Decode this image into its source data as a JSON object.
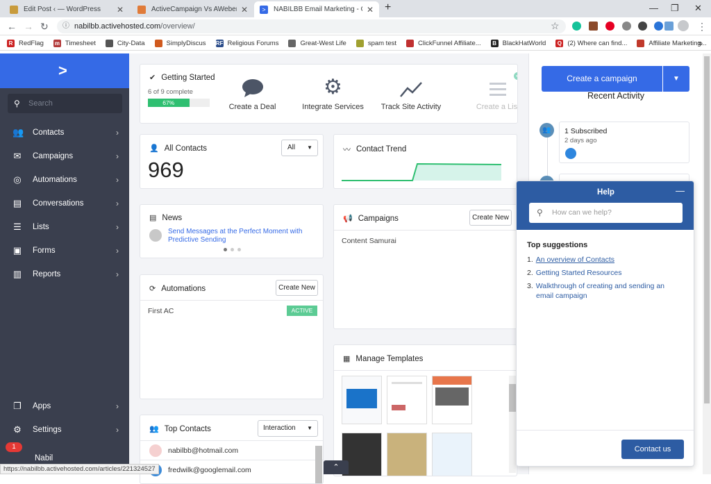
{
  "browser": {
    "tabs": [
      {
        "title": "Edit Post ‹ — WordPress",
        "color": "#c89b3c"
      },
      {
        "title": "ActiveCampaign Vs AWeber - Wh",
        "color": "#e07b39"
      },
      {
        "title": "NABILBB Email Marketing - Overv",
        "color": "#356ae6"
      }
    ],
    "url_host": "nabilbb.activehosted.com",
    "url_path": "/overview/",
    "bookmarks": [
      {
        "label": "RedFlag",
        "color": "#cc2222",
        "glyph": "R"
      },
      {
        "label": "Timesheet",
        "color": "#b33a3a",
        "glyph": "m"
      },
      {
        "label": "City-Data",
        "color": "#555555",
        "glyph": ""
      },
      {
        "label": "SimplyDiscus",
        "color": "#d05a1e",
        "glyph": ""
      },
      {
        "label": "Religious Forums",
        "color": "#2a4c8a",
        "glyph": "RF"
      },
      {
        "label": "Great-West Life",
        "color": "#666666",
        "glyph": ""
      },
      {
        "label": "spam test",
        "color": "#a0a030",
        "glyph": ""
      },
      {
        "label": "ClickFunnel Affiliate...",
        "color": "#c03030",
        "glyph": ""
      },
      {
        "label": "BlackHatWorld",
        "color": "#222222",
        "glyph": "B"
      },
      {
        "label": "(2) Where can find...",
        "color": "#cc2222",
        "glyph": "Q"
      },
      {
        "label": "Affiliate Marketing...",
        "color": "#c0392b",
        "glyph": ""
      }
    ]
  },
  "sidebar": {
    "search_placeholder": "Search",
    "items": [
      {
        "label": "Contacts",
        "icon": "contacts-icon",
        "glyph": "👥"
      },
      {
        "label": "Campaigns",
        "icon": "envelope-icon",
        "glyph": "✉"
      },
      {
        "label": "Automations",
        "icon": "automation-icon",
        "glyph": "◎"
      },
      {
        "label": "Conversations",
        "icon": "chat-icon",
        "glyph": "▤"
      },
      {
        "label": "Lists",
        "icon": "list-icon",
        "glyph": "☰"
      },
      {
        "label": "Forms",
        "icon": "form-icon",
        "glyph": "▣"
      },
      {
        "label": "Reports",
        "icon": "chart-icon",
        "glyph": "▥"
      }
    ],
    "bottom": [
      {
        "label": "Apps",
        "icon": "apps-icon",
        "glyph": "❐"
      },
      {
        "label": "Settings",
        "icon": "gear-icon",
        "glyph": "⚙"
      }
    ],
    "user": {
      "name": "Nabil",
      "badge": "1"
    }
  },
  "getting_started": {
    "title": "Getting Started",
    "progress_text": "6 of 9 complete",
    "progress_pct": "67%",
    "progress_value": 0.67,
    "steps": [
      "Create a Deal",
      "Integrate Services",
      "Track Site Activity",
      "Create a List"
    ]
  },
  "all_contacts": {
    "title": "All Contacts",
    "filter": "All",
    "count": "969"
  },
  "contact_trend": {
    "title": "Contact Trend"
  },
  "news": {
    "title": "News",
    "headline": "Send Messages at the Perfect Moment with Predictive Sending"
  },
  "campaigns": {
    "title": "Campaigns",
    "button": "Create New",
    "item": "Content Samurai"
  },
  "automations": {
    "title": "Automations",
    "button": "Create New",
    "item": "First AC",
    "status": "ACTIVE"
  },
  "templates": {
    "title": "Manage Templates"
  },
  "top_contacts": {
    "title": "Top Contacts",
    "filter": "Interaction",
    "contacts": [
      "nabilbb@hotmail.com",
      "fredwilk@googlemail.com"
    ]
  },
  "right": {
    "create_button": "Create a campaign",
    "recent_title": "Recent Activity",
    "activity": {
      "title": "1 Subscribed",
      "time": "2 days ago"
    }
  },
  "help": {
    "title": "Help",
    "search_placeholder": "How can we help?",
    "suggestions_title": "Top suggestions",
    "suggestions": [
      "An overview of Contacts",
      "Getting Started Resources",
      "Walkthrough of creating and sending an email campaign"
    ],
    "contact_button": "Contact us"
  },
  "status_url": "https://nabilbb.activehosted.com/articles/221324527"
}
